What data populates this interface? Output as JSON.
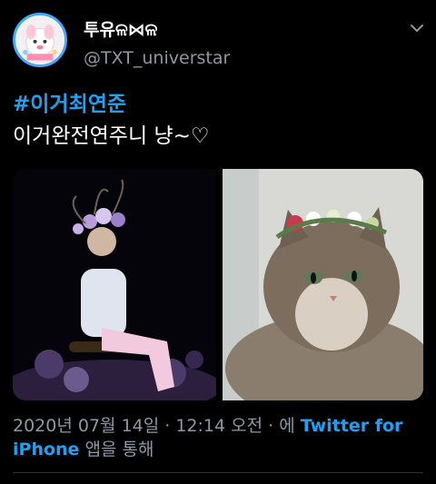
{
  "header": {
    "display_name": "투유ଳ⋈ଳ",
    "handle": "@TXT_universtar",
    "menu_icon": "chevron-down-icon",
    "avatar_icon": "cartoon-character-avatar"
  },
  "tweet": {
    "hashtag": "#이거최연준",
    "text": "이거완전연주니 냥~♡"
  },
  "media": {
    "left_image": "person-with-flower-crown-sitting-on-stage",
    "right_image": "cat-with-flower-crown"
  },
  "meta": {
    "timestamp": "2020년 07월 14일 · 12:14 오전 · 에",
    "source": "Twitter for iPhone",
    "suffix": "앱을 통해"
  },
  "colors": {
    "background": "#000000",
    "accent": "#1da1f2",
    "muted": "#8b98a5"
  }
}
